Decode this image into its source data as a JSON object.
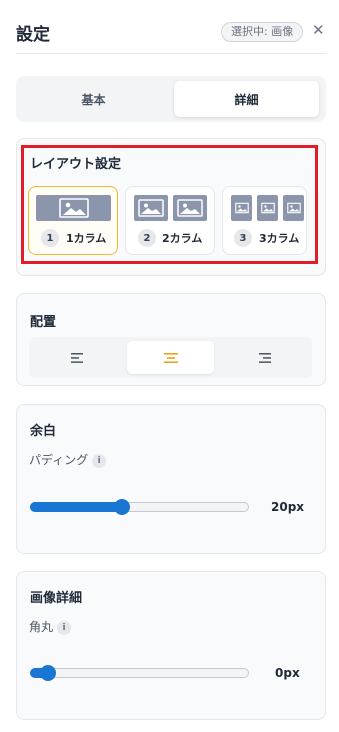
{
  "header": {
    "title": "設定",
    "badge": "選択中: 画像",
    "close_icon": "close-icon"
  },
  "tabs": [
    {
      "label": "基本",
      "selected": false
    },
    {
      "label": "詳細",
      "selected": true
    }
  ],
  "layout_section": {
    "title": "レイアウト設定",
    "options": [
      {
        "number": "1",
        "label": "1カラム",
        "selected": true
      },
      {
        "number": "2",
        "label": "2カラム",
        "selected": false
      },
      {
        "number": "3",
        "label": "3カラム",
        "selected": false
      }
    ]
  },
  "align_section": {
    "title": "配置",
    "options": [
      {
        "icon": "align-left-icon",
        "selected": false
      },
      {
        "icon": "align-center-icon",
        "selected": true
      },
      {
        "icon": "align-right-icon",
        "selected": false
      }
    ],
    "selected_color": "#e8a317"
  },
  "margin_section": {
    "title": "余白",
    "padding_label": "パディング",
    "info_glyph": "i",
    "padding_value": "20px",
    "padding_level": 0.42
  },
  "image_section": {
    "title": "画像詳細",
    "radius_label": "角丸",
    "info_glyph": "i",
    "radius_value": "0px",
    "radius_level": 0.08
  },
  "colors": {
    "accent": "#1976d2",
    "selected_border": "#f5b82e",
    "highlight": "#e11d2a"
  }
}
